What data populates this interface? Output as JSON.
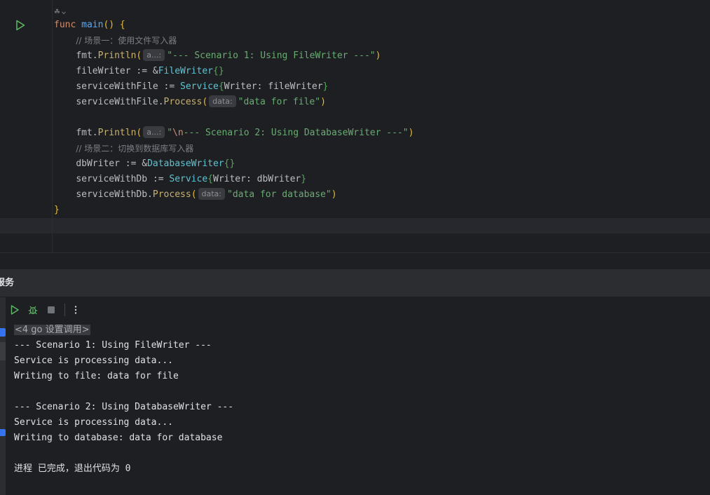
{
  "editor": {
    "usage_hint": "☘",
    "lines": {
      "l1": {
        "kw": "func",
        "name": "main",
        "rest": "() {"
      },
      "l2": {
        "comment": "// 场景一：使用文件写入器"
      },
      "l3": {
        "pkg": "fmt.",
        "call": "Println",
        "open": "(",
        "hint": "a...:",
        "str": "\"--- Scenario 1: Using FileWriter ---\"",
        "close": ")"
      },
      "l4": {
        "var": "fileWriter := &",
        "type": "FileWriter",
        "braces": "{}"
      },
      "l5": {
        "var": "serviceWithFile := ",
        "type": "Service",
        "open": "{",
        "field": "Writer: fileWriter",
        "close": "}"
      },
      "l6": {
        "var": "serviceWithFile.",
        "call": "Process",
        "open": "(",
        "hint": "data:",
        "str": "\"data for file\"",
        "close": ")"
      },
      "l8": {
        "pkg": "fmt.",
        "call": "Println",
        "open": "(",
        "hint": "a...:",
        "str_pre": "\"",
        "esc": "\\n",
        "str": "--- Scenario 2: Using DatabaseWriter ---\"",
        "close": ")"
      },
      "l9": {
        "comment": "// 场景二：切换到数据库写入器"
      },
      "l10": {
        "var": "dbWriter := &",
        "type": "DatabaseWriter",
        "braces": "{}"
      },
      "l11": {
        "var": "serviceWithDb := ",
        "type": "Service",
        "open": "{",
        "field": "Writer: dbWriter",
        "close": "}"
      },
      "l12": {
        "var": "serviceWithDb.",
        "call": "Process",
        "open": "(",
        "hint": "data:",
        "str": "\"data for database\"",
        "close": ")"
      },
      "l13": {
        "close": "}"
      }
    }
  },
  "tool_window": {
    "title": "服务",
    "toolbar": {
      "run": "run-icon",
      "debug": "debug-icon",
      "stop": "stop-icon",
      "more": "more-icon"
    },
    "console": {
      "header": "<4 go 设置调用>",
      "lines": [
        "--- Scenario 1: Using FileWriter ---",
        "Service is processing data...",
        "Writing to file: data for file",
        "",
        "--- Scenario 2: Using DatabaseWriter ---",
        "Service is processing data...",
        "Writing to database: data for database",
        "",
        "进程 已完成，退出代码为 0"
      ]
    }
  },
  "colors": {
    "background": "#1e1f22",
    "panel": "#2b2d30",
    "keyword": "#cf8e6d",
    "function": "#57aaf7",
    "type": "#5ec4d4",
    "string": "#6aab73",
    "run_green": "#5fb865",
    "accent_blue": "#3574f0"
  }
}
